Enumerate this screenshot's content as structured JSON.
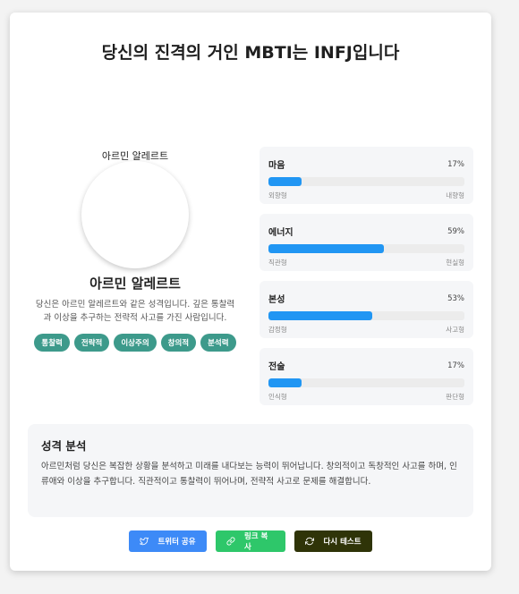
{
  "header": {
    "title": "당신의 진격의 거인 MBTI는 INFJ입니다"
  },
  "profile": {
    "avatar_alt": "아르민 알레르트",
    "name": "아르민 알레르트",
    "description": "당신은 아르민 알레르트와 같은 성격입니다. 깊은 통찰력과 이상을 추구하는 전략적 사고를 가진 사람입니다.",
    "tags": [
      "통찰력",
      "전략적",
      "이상주의",
      "창의적",
      "분석력"
    ]
  },
  "traits": [
    {
      "name": "마음",
      "percent_label": "17%",
      "value": 17,
      "left": "외향형",
      "right": "내향형"
    },
    {
      "name": "에너지",
      "percent_label": "59%",
      "value": 59,
      "left": "직관형",
      "right": "현실형"
    },
    {
      "name": "본성",
      "percent_label": "53%",
      "value": 53,
      "left": "감정형",
      "right": "사고형"
    },
    {
      "name": "전술",
      "percent_label": "17%",
      "value": 17,
      "left": "인식형",
      "right": "판단형"
    }
  ],
  "analysis": {
    "title": "성격 분석",
    "body": "아르민처럼 당신은 복잡한 상황을 분석하고 미래를 내다보는 능력이 뛰어납니다. 창의적이고 독창적인 사고를 하며, 인류애와 이상을 추구합니다. 직관적이고 통찰력이 뛰어나며, 전략적 사고로 문제를 해결합니다."
  },
  "actions": {
    "twitter_label": "트위터 공유",
    "link_label": "링크 복사",
    "retry_label": "다시 테스트"
  },
  "colors": {
    "accent": "#2196f3",
    "tag": "#3d9a8b",
    "twitter": "#3d8af7",
    "link": "#2ec76a",
    "retry": "#2f3408"
  },
  "icons": {
    "twitter": "bird-icon",
    "link": "link-icon",
    "retry": "refresh-icon"
  }
}
